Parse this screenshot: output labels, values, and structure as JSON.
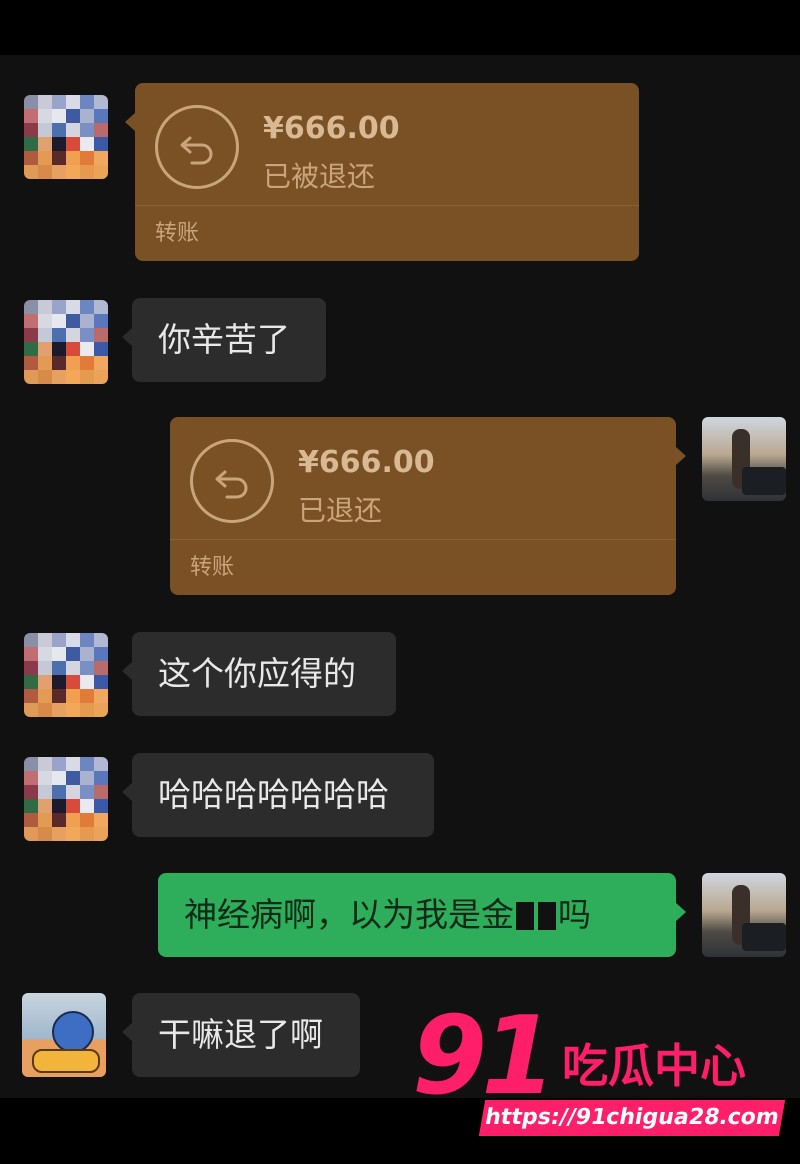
{
  "messages": [
    {
      "side": "left",
      "type": "transfer",
      "amount": "¥666.00",
      "status": "已被退还",
      "label": "转账"
    },
    {
      "side": "left",
      "type": "text",
      "text": "你辛苦了"
    },
    {
      "side": "right",
      "type": "transfer",
      "amount": "¥666.00",
      "status": "已退还",
      "label": "转账"
    },
    {
      "side": "left",
      "type": "text",
      "text": "这个你应得的"
    },
    {
      "side": "left",
      "type": "text",
      "text": "哈哈哈哈哈哈哈"
    },
    {
      "side": "right",
      "type": "text",
      "text_before": "神经病啊，以为我是金",
      "text_after": "吗"
    },
    {
      "side": "left",
      "type": "text",
      "text": "干嘛退了啊"
    }
  ],
  "watermark": {
    "logo": "91",
    "name": "吃瓜中心",
    "url": "https://91chigua28.com"
  },
  "icons": {
    "transfer_returned": "return-arrow-icon"
  },
  "colors": {
    "transfer_bubble": "#7a5125",
    "sent_bubble": "#2eae5b",
    "received_bubble": "#2c2c2c",
    "watermark": "#ff1e6a"
  }
}
